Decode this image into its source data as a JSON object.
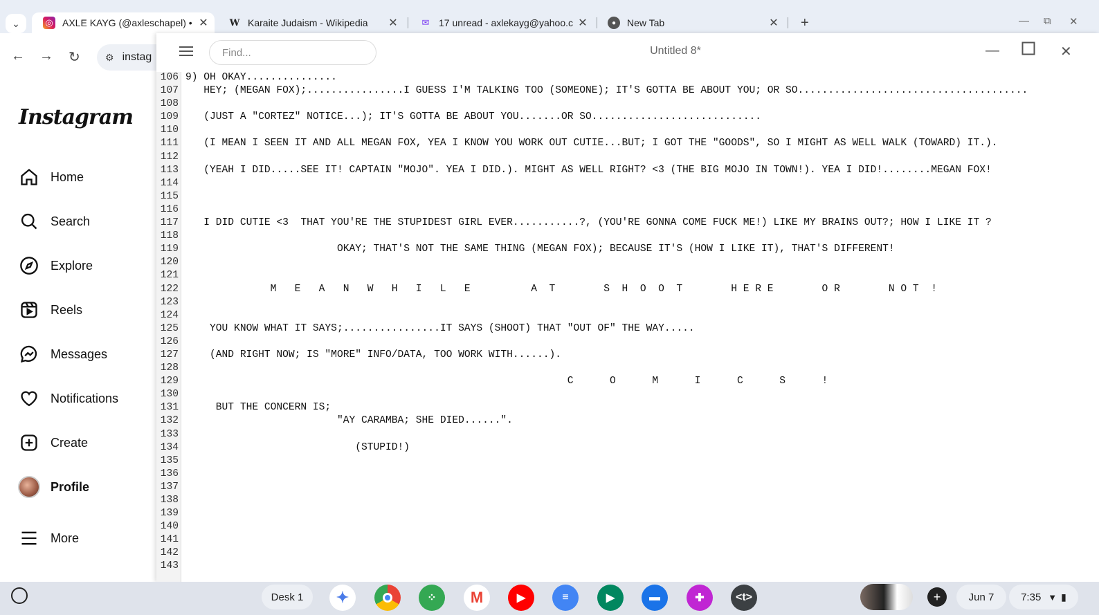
{
  "browser": {
    "tabs": [
      {
        "title": "AXLE KAYG (@axleschapel) • In",
        "favicon": "instagram-icon",
        "active": true
      },
      {
        "title": "Karaite Judaism - Wikipedia",
        "favicon": "wikipedia-icon",
        "active": false
      },
      {
        "title": "17 unread - axlekayg@yahoo.c",
        "favicon": "mail-icon",
        "active": false
      },
      {
        "title": "New Tab",
        "favicon": "chrome-icon",
        "active": false
      }
    ],
    "address": "instag"
  },
  "instagram": {
    "logo": "Instagram",
    "nav": [
      {
        "label": "Home",
        "icon": "home-icon"
      },
      {
        "label": "Search",
        "icon": "search-icon"
      },
      {
        "label": "Explore",
        "icon": "explore-icon"
      },
      {
        "label": "Reels",
        "icon": "reels-icon"
      },
      {
        "label": "Messages",
        "icon": "messages-icon"
      },
      {
        "label": "Notifications",
        "icon": "heart-icon"
      },
      {
        "label": "Create",
        "icon": "create-icon"
      },
      {
        "label": "Profile",
        "icon": "avatar"
      },
      {
        "label": "More",
        "icon": "menu-icon"
      }
    ]
  },
  "editor": {
    "find_placeholder": "Find...",
    "title": "Untitled 8*",
    "lines": [
      {
        "n": "106",
        "t": "9) OH OKAY..............."
      },
      {
        "n": "107",
        "t": "   HEY; (MEGAN FOX);................I GUESS I'M TALKING TOO (SOMEONE); IT'S GOTTA BE ABOUT YOU; OR SO......................................"
      },
      {
        "n": "108",
        "t": ""
      },
      {
        "n": "109",
        "t": "   (JUST A \"CORTEZ\" NOTICE...); IT'S GOTTA BE ABOUT YOU.......OR SO............................"
      },
      {
        "n": "110",
        "t": ""
      },
      {
        "n": "111",
        "t": "   (I MEAN I SEEN IT AND ALL MEGAN FOX, YEA I KNOW YOU WORK OUT CUTIE...BUT; I GOT THE \"GOODS\", SO I MIGHT AS WELL WALK (TOWARD) IT.)."
      },
      {
        "n": "112",
        "t": ""
      },
      {
        "n": "113",
        "t": "   (YEAH I DID.....SEE IT! CAPTAIN \"MOJO\". YEA I DID.). MIGHT AS WELL RIGHT? <3 (THE BIG MOJO IN TOWN!). YEA I DID!........MEGAN FOX!"
      },
      {
        "n": "114",
        "t": ""
      },
      {
        "n": "115",
        "t": ""
      },
      {
        "n": "116",
        "t": ""
      },
      {
        "n": "117",
        "t": "   I DID CUTIE <3  THAT YOU'RE THE STUPIDEST GIRL EVER...........?, (YOU'RE GONNA COME FUCK ME!) LIKE MY BRAINS OUT?; HOW I LIKE IT ?"
      },
      {
        "n": "118",
        "t": ""
      },
      {
        "n": "119",
        "t": "                         OKAY; THAT'S NOT THE SAME THING (MEGAN FOX); BECAUSE IT'S (HOW I LIKE IT), THAT'S DIFFERENT!"
      },
      {
        "n": "120",
        "t": ""
      },
      {
        "n": "121",
        "t": ""
      },
      {
        "n": "122",
        "t": "              M   E   A   N   W   H   I   L   E          A  T        S  H  O  O  T        H E R E        O R        N O T  !"
      },
      {
        "n": "123",
        "t": ""
      },
      {
        "n": "124",
        "t": ""
      },
      {
        "n": "125",
        "t": "    YOU KNOW WHAT IT SAYS;................IT SAYS (SHOOT) THAT \"OUT OF\" THE WAY....."
      },
      {
        "n": "126",
        "t": ""
      },
      {
        "n": "127",
        "t": "    (AND RIGHT NOW; IS \"MORE\" INFO/DATA, TOO WORK WITH......)."
      },
      {
        "n": "128",
        "t": ""
      },
      {
        "n": "129",
        "t": "                                                               C      O      M      I      C      S      !"
      },
      {
        "n": "130",
        "t": ""
      },
      {
        "n": "131",
        "t": "     BUT THE CONCERN IS;"
      },
      {
        "n": "132",
        "t": "                         \"AY CARAMBA; SHE DIED......\"."
      },
      {
        "n": "133",
        "t": ""
      },
      {
        "n": "134",
        "t": "                            (STUPID!)"
      },
      {
        "n": "135",
        "t": ""
      },
      {
        "n": "136",
        "t": ""
      },
      {
        "n": "137",
        "t": ""
      },
      {
        "n": "138",
        "t": ""
      },
      {
        "n": "139",
        "t": ""
      },
      {
        "n": "140",
        "t": ""
      },
      {
        "n": "141",
        "t": ""
      },
      {
        "n": "142",
        "t": ""
      },
      {
        "n": "143",
        "t": ""
      }
    ]
  },
  "shelf": {
    "desk": "Desk 1",
    "date": "Jun 7",
    "time": "7:35",
    "apps": [
      {
        "name": "gemini-icon",
        "label": "✦",
        "color": "#4a7be8"
      },
      {
        "name": "chrome-icon",
        "label": "",
        "color": "#db4437"
      },
      {
        "name": "apps-icon",
        "label": "⁘",
        "color": "#34a853"
      },
      {
        "name": "gmail-icon",
        "label": "M",
        "color": "#ea4335"
      },
      {
        "name": "youtube-icon",
        "label": "▶",
        "color": "#ff0000"
      },
      {
        "name": "docs-icon",
        "label": "≡",
        "color": "#4285f4"
      },
      {
        "name": "play-store-icon",
        "label": "▶",
        "color": "#01875f"
      },
      {
        "name": "files-icon",
        "label": "▬",
        "color": "#1a73e8"
      },
      {
        "name": "photo-app-icon",
        "label": "✚",
        "color": "#c026d3"
      },
      {
        "name": "terminal-icon",
        "label": "<t>",
        "color": "#3c4043"
      }
    ]
  }
}
